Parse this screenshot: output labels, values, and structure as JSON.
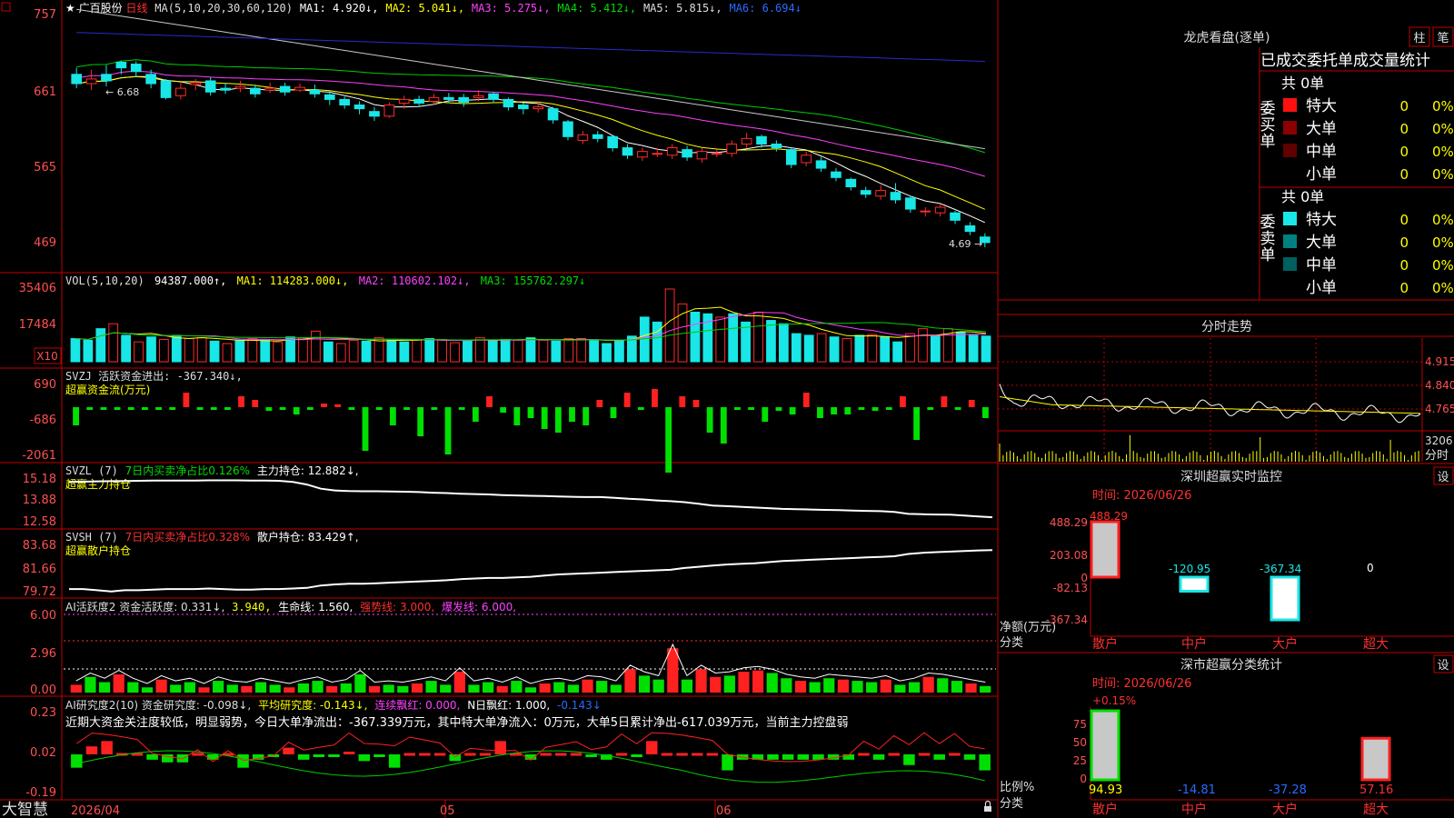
{
  "colors": {
    "bg": "#000000",
    "frame": "#c00000",
    "up": "#ff2a2a",
    "down": "#19e6e6",
    "ma1": "#ffffff",
    "ma2": "#ffff00",
    "ma3": "#ff40ff",
    "ma4": "#00cc00",
    "ma5": "#c8c8c8",
    "ma6": "#2a2ad0",
    "green": "#00e000",
    "red": "#ff2020",
    "text_white": "#ffffff",
    "text_yellow": "#ffff00",
    "text_green": "#00e000",
    "text_red": "#ff3030",
    "text_magenta": "#ff40ff",
    "text_blue": "#2a6aff",
    "label_red": "#ff5050"
  },
  "header": {
    "menu_icon": "square-menu-icon",
    "star": "★",
    "stock_name": "广百股份",
    "period": "日线",
    "ma_label": "MA(5,10,20,30,60,120)",
    "ma1": "MA1: 4.920↓,",
    "ma2": "MA2: 5.041↓,",
    "ma3": "MA3: 5.275↓,",
    "ma4": "MA4: 5.412↓,",
    "ma5": "MA5: 5.815↓,",
    "ma6": "MA6: 6.694↓"
  },
  "panels": {
    "price": {
      "ticks": [
        "757",
        "661",
        "565",
        "469"
      ],
      "high_label": "6.68",
      "low_label": "4.69"
    },
    "vol": {
      "ticks": [
        "35406",
        "17484"
      ],
      "unit_badge": "X10",
      "title": "VOL(5,10,20)",
      "value": "94387.000↑,",
      "ma1": "MA1: 114283.000↓,",
      "ma2": "MA2: 110602.102↓,",
      "ma3": "MA3: 155762.297↓"
    },
    "svzj": {
      "ticks": [
        "690",
        "-686",
        "-2061"
      ],
      "title": "SVZJ  活跃资金进出: -367.340↓,",
      "subtitle": "超赢资金流(万元)"
    },
    "svzl": {
      "ticks": [
        "15.18",
        "13.88",
        "12.58"
      ],
      "title": "SVZL (7)",
      "t2": "7日内买卖净占比0.126%",
      "t3": "主力持仓: 12.882↓,",
      "subtitle": "超赢主力持仓"
    },
    "svsh": {
      "ticks": [
        "83.68",
        "81.66",
        "79.72"
      ],
      "title": "SVSH (7)",
      "t2": "7日内买卖净占比0.328%",
      "t3": "散户持仓: 83.429↑,",
      "subtitle": "超赢散户持仓"
    },
    "aihyd": {
      "ticks": [
        "6.00",
        "2.96",
        "0.00"
      ],
      "t1": "AI活跃度2 资金活跃度: 0.331↓,",
      "t2": "3.940,",
      "t3": "生命线: 1.560,",
      "t4": "强势线: 3.000,",
      "t5": "爆发线: 6.000,"
    },
    "aiyj": {
      "ticks": [
        "0.23",
        "0.02",
        "-0.19"
      ],
      "t1": "AI研究度2(10) 资金研究度: -0.098↓,",
      "t2": "平均研究度: -0.143↓,",
      "t3": "连续飘红: 0.000,",
      "t4": "N日飘红: 1.000,",
      "t5": "-0.143↓",
      "comment": "近期大资金关注度较低，明显弱势，今日大单净流出：-367.339万元，其中特大单净流入：0万元，大单5日累计净出-617.039万元，当前主力控盘弱"
    }
  },
  "xaxis": {
    "labels": [
      "2026/04",
      "05",
      "06"
    ]
  },
  "footer": {
    "brand": "大智慧",
    "lock_icon": "lock-icon"
  },
  "right": {
    "lhb": {
      "title": "龙虎看盘(逐单)",
      "btn1": "柱",
      "btn2": "笔",
      "subtitle": "已成交委托单成交量统计",
      "buy_label": "委买单",
      "sell_label": "委卖单",
      "buy_total": "共 0单",
      "sell_total": "共 0单",
      "buy_rows": [
        {
          "name": "特大",
          "val": "0",
          "pct": "0%"
        },
        {
          "name": "大单",
          "val": "0",
          "pct": "0%"
        },
        {
          "name": "中单",
          "val": "0",
          "pct": "0%"
        },
        {
          "name": "小单",
          "val": "0",
          "pct": "0%"
        }
      ],
      "sell_rows": [
        {
          "name": "特大",
          "val": "0",
          "pct": "0%"
        },
        {
          "name": "大单",
          "val": "0",
          "pct": "0%"
        },
        {
          "name": "中单",
          "val": "0",
          "pct": "0%"
        },
        {
          "name": "小单",
          "val": "0",
          "pct": "0%"
        }
      ]
    },
    "intraday": {
      "title": "分时走势",
      "ticks": [
        "4.915",
        "4.840",
        "4.765"
      ],
      "vol_label": "3206",
      "unit": "分时"
    },
    "szrt": {
      "title": "深圳超赢实时监控",
      "btn": "设",
      "date": "时间: 2026/06/26",
      "ylabel": "净额(万元)",
      "xlabel": "分类",
      "ticks": [
        "488.29",
        "203.08",
        "0",
        "-82.13",
        "-367.34"
      ],
      "categories": [
        "散户",
        "中户",
        "大户",
        "超大"
      ],
      "values": [
        488.29,
        -120.95,
        -367.34,
        0
      ],
      "value_labels": [
        "488.29",
        "-120.95",
        "-367.34",
        "0"
      ]
    },
    "szcls": {
      "title": "深市超赢分类统计",
      "btn": "设",
      "date": "时间: 2026/06/26",
      "ylabel": "比例%",
      "xlabel": "分类",
      "top_label": "+0.15%",
      "ticks": [
        "75",
        "50",
        "25",
        "0"
      ],
      "categories": [
        "散户",
        "中户",
        "大户",
        "超大"
      ],
      "values": [
        94.93,
        -14.81,
        -37.28,
        57.16
      ],
      "value_labels": [
        "94.93",
        "-14.81",
        "-37.28",
        "57.16"
      ]
    }
  },
  "chart_data": [
    {
      "type": "candlestick",
      "title": "广百股份 日线",
      "ylim": [
        4.6,
        7.6
      ],
      "ohlc": [
        [
          6.55,
          6.45,
          6.62,
          6.4
        ],
        [
          6.45,
          6.5,
          6.6,
          6.38
        ],
        [
          6.55,
          6.48,
          6.65,
          6.42
        ],
        [
          6.68,
          6.62,
          6.7,
          6.55
        ],
        [
          6.66,
          6.58,
          6.69,
          6.52
        ],
        [
          6.55,
          6.45,
          6.6,
          6.4
        ],
        [
          6.48,
          6.3,
          6.5,
          6.28
        ],
        [
          6.32,
          6.4,
          6.46,
          6.28
        ],
        [
          6.44,
          6.46,
          6.5,
          6.38
        ],
        [
          6.48,
          6.36,
          6.52,
          6.32
        ],
        [
          6.4,
          6.38,
          6.46,
          6.34
        ],
        [
          6.4,
          6.42,
          6.48,
          6.36
        ],
        [
          6.4,
          6.34,
          6.44,
          6.3
        ],
        [
          6.38,
          6.4,
          6.46,
          6.35
        ],
        [
          6.42,
          6.36,
          6.46,
          6.32
        ],
        [
          6.38,
          6.41,
          6.45,
          6.36
        ],
        [
          6.38,
          6.34,
          6.44,
          6.3
        ],
        [
          6.33,
          6.28,
          6.37,
          6.22
        ],
        [
          6.28,
          6.22,
          6.31,
          6.18
        ],
        [
          6.22,
          6.18,
          6.26,
          6.12
        ],
        [
          6.15,
          6.1,
          6.2,
          6.05
        ],
        [
          6.1,
          6.22,
          6.25,
          6.08
        ],
        [
          6.24,
          6.28,
          6.32,
          6.18
        ],
        [
          6.28,
          6.24,
          6.32,
          6.2
        ],
        [
          6.26,
          6.3,
          6.34,
          6.22
        ],
        [
          6.3,
          6.28,
          6.35,
          6.24
        ],
        [
          6.3,
          6.25,
          6.34,
          6.2
        ],
        [
          6.3,
          6.32,
          6.38,
          6.26
        ],
        [
          6.34,
          6.28,
          6.36,
          6.24
        ],
        [
          6.28,
          6.2,
          6.3,
          6.16
        ],
        [
          6.22,
          6.18,
          6.24,
          6.12
        ],
        [
          6.18,
          6.2,
          6.26,
          6.14
        ],
        [
          6.18,
          6.06,
          6.2,
          6.02
        ],
        [
          6.04,
          5.88,
          6.06,
          5.84
        ],
        [
          5.84,
          5.9,
          5.94,
          5.8
        ],
        [
          5.9,
          5.86,
          5.94,
          5.82
        ],
        [
          5.88,
          5.76,
          5.9,
          5.72
        ],
        [
          5.76,
          5.68,
          5.8,
          5.64
        ],
        [
          5.66,
          5.72,
          5.76,
          5.62
        ],
        [
          5.7,
          5.7,
          5.76,
          5.66
        ],
        [
          5.68,
          5.76,
          5.8,
          5.64
        ],
        [
          5.74,
          5.66,
          5.78,
          5.62
        ],
        [
          5.64,
          5.72,
          5.76,
          5.6
        ],
        [
          5.7,
          5.7,
          5.74,
          5.66
        ],
        [
          5.7,
          5.8,
          5.84,
          5.66
        ],
        [
          5.8,
          5.86,
          5.92,
          5.76
        ],
        [
          5.88,
          5.8,
          5.9,
          5.76
        ],
        [
          5.8,
          5.76,
          5.84,
          5.72
        ],
        [
          5.74,
          5.58,
          5.76,
          5.54
        ],
        [
          5.6,
          5.68,
          5.72,
          5.56
        ],
        [
          5.62,
          5.54,
          5.66,
          5.5
        ],
        [
          5.5,
          5.44,
          5.54,
          5.4
        ],
        [
          5.42,
          5.34,
          5.44,
          5.3
        ],
        [
          5.3,
          5.26,
          5.34,
          5.22
        ],
        [
          5.24,
          5.3,
          5.36,
          5.2
        ],
        [
          5.28,
          5.2,
          5.38,
          5.16
        ],
        [
          5.22,
          5.1,
          5.24,
          5.06
        ],
        [
          5.08,
          5.08,
          5.12,
          5.02
        ],
        [
          5.06,
          5.12,
          5.16,
          5.02
        ],
        [
          5.06,
          4.98,
          5.08,
          4.94
        ],
        [
          4.92,
          4.86,
          4.96,
          4.82
        ],
        [
          4.8,
          4.74,
          4.84,
          4.69
        ]
      ]
    },
    {
      "type": "bar",
      "title": "VOL(5,10,20)",
      "ylim": [
        0,
        50000
      ],
      "values": [
        14000,
        13000,
        20000,
        23000,
        16000,
        12000,
        15000,
        13500,
        16000,
        14000,
        14500,
        12500,
        11000,
        13000,
        14000,
        13000,
        12000,
        15000,
        14500,
        18500,
        12000,
        11000,
        13000,
        12500,
        14500,
        13000,
        12000,
        13500,
        14000,
        13500,
        11500,
        12500,
        14500,
        13000,
        13500,
        13000,
        14500,
        13000,
        12500,
        14000,
        14000,
        13000,
        11000,
        13000,
        15500,
        27000,
        24000,
        44000,
        35000,
        30000,
        29000,
        27000,
        29000,
        24000,
        30000,
        25000,
        23000,
        17000,
        16000,
        17000,
        15000,
        14000,
        16000,
        16500,
        15000,
        12000,
        17000,
        20000,
        16000,
        20000,
        18000,
        16000,
        15500
      ],
      "up": [
        0,
        0,
        0,
        1,
        0,
        1,
        0,
        1,
        0,
        1,
        1,
        0,
        1,
        0,
        1,
        0,
        1,
        0,
        1,
        1,
        0,
        1,
        1,
        0,
        1,
        0,
        0,
        1,
        0,
        1,
        1,
        0,
        1,
        0,
        0,
        1,
        0,
        1,
        0,
        1,
        1,
        0,
        0,
        0,
        0,
        0,
        0,
        1,
        1,
        0,
        0,
        1,
        0,
        0,
        1,
        0,
        0,
        0,
        0,
        1,
        0,
        1,
        0,
        1,
        0,
        0,
        1,
        1,
        0,
        1,
        0,
        0,
        0
      ]
    },
    {
      "type": "bar",
      "title": "超赢资金流(万元)",
      "ylim": [
        -2061,
        690
      ],
      "values": [
        -500,
        0,
        0,
        0,
        0,
        0,
        0,
        0,
        400,
        0,
        0,
        0,
        300,
        200,
        -100,
        0,
        -200,
        0,
        100,
        80,
        0,
        -1200,
        0,
        -500,
        0,
        -800,
        0,
        -1300,
        0,
        -400,
        300,
        -150,
        -500,
        -300,
        -600,
        -700,
        -400,
        -500,
        200,
        -300,
        400,
        0,
        500,
        -1800,
        300,
        200,
        -700,
        -1000,
        0,
        0,
        -400,
        -100,
        -200,
        400,
        -300,
        -200,
        -200,
        0,
        -100,
        0,
        300,
        -900,
        0,
        300,
        0,
        200,
        -300
      ]
    },
    {
      "type": "line",
      "title": "超赢主力持仓",
      "ylim": [
        12.58,
        15.18
      ],
      "values": [
        15.0,
        15.02,
        15.04,
        15.05,
        15.06,
        15.07,
        15.08,
        15.08,
        15.09,
        15.09,
        15.1,
        15.1,
        15.1,
        15.09,
        15.08,
        15.07,
        15.0,
        14.85,
        14.6,
        14.5,
        14.46,
        14.45,
        14.45,
        14.44,
        14.42,
        14.4,
        14.36,
        14.34,
        14.3,
        14.28,
        14.26,
        14.22,
        14.2,
        14.18,
        14.16,
        14.14,
        14.12,
        14.1,
        14.1,
        14.06,
        14.0,
        13.96,
        13.9,
        13.86,
        13.8,
        13.7,
        13.6,
        13.56,
        13.52,
        13.48,
        13.44,
        13.4,
        13.38,
        13.36,
        13.34,
        13.32,
        13.3,
        13.28,
        13.26,
        13.22,
        13.1,
        13.08,
        13.06,
        13.05,
        13.0,
        12.95,
        12.9
      ]
    },
    {
      "type": "line",
      "title": "超赢散户持仓",
      "ylim": [
        79.72,
        83.68
      ],
      "values": [
        80.1,
        80.1,
        80.0,
        79.9,
        80.0,
        80.0,
        80.05,
        80.1,
        80.1,
        80.1,
        80.15,
        80.1,
        80.05,
        80.05,
        80.1,
        80.1,
        80.15,
        80.2,
        80.4,
        80.5,
        80.55,
        80.55,
        80.6,
        80.65,
        80.7,
        80.75,
        80.8,
        80.85,
        80.95,
        81.0,
        81.05,
        81.05,
        81.1,
        81.15,
        81.25,
        81.35,
        81.4,
        81.45,
        81.5,
        81.55,
        81.6,
        81.65,
        81.7,
        81.75,
        81.9,
        82.0,
        82.1,
        82.2,
        82.25,
        82.3,
        82.4,
        82.5,
        82.55,
        82.6,
        82.65,
        82.7,
        82.75,
        82.8,
        82.85,
        82.9,
        83.1,
        83.2,
        83.25,
        83.3,
        83.35,
        83.4,
        83.43
      ]
    },
    {
      "type": "bar",
      "title": "AI活跃度2",
      "ylim": [
        0,
        6
      ],
      "values": [
        0.6,
        1.2,
        0.8,
        1.4,
        0.8,
        0.4,
        1.0,
        0.6,
        0.8,
        0.4,
        0.9,
        0.6,
        0.5,
        0.8,
        0.6,
        0.4,
        0.7,
        0.9,
        0.5,
        0.7,
        1.4,
        0.5,
        0.6,
        0.5,
        0.7,
        0.9,
        0.6,
        1.6,
        0.6,
        0.8,
        0.5,
        0.9,
        0.4,
        0.7,
        0.8,
        0.6,
        1.0,
        0.9,
        0.6,
        1.8,
        1.3,
        1.0,
        3.4,
        1.0,
        1.8,
        1.2,
        1.3,
        1.6,
        1.7,
        1.5,
        1.1,
        0.9,
        0.8,
        1.1,
        1.0,
        0.9,
        0.8,
        1.0,
        0.6,
        0.8,
        1.2,
        1.1,
        0.9,
        0.7,
        0.5
      ]
    },
    {
      "type": "bar",
      "title": "AI研究度2(10)",
      "ylim": [
        -0.19,
        0.23
      ],
      "values": [
        -0.1,
        0.06,
        0.1,
        0.0,
        0.0,
        -0.04,
        -0.06,
        -0.06,
        0.0,
        -0.04,
        0.0,
        -0.1,
        -0.04,
        -0.02,
        0.05,
        -0.04,
        -0.02,
        -0.02,
        0.02,
        -0.05,
        -0.02,
        -0.1,
        0.0,
        0.0,
        0.0,
        -0.05,
        0.0,
        0.0,
        0.1,
        0.0,
        -0.04,
        0.0,
        0.0,
        0.0,
        -0.02,
        -0.04,
        0.0,
        -0.02,
        0.1,
        0.0,
        0.0,
        0.0,
        0.0,
        -0.12,
        -0.04,
        -0.04,
        -0.04,
        -0.04,
        -0.04,
        -0.04,
        -0.04,
        -0.04,
        0.0,
        -0.04,
        0.0,
        -0.08,
        0.0,
        -0.04,
        0.0,
        -0.04,
        -0.12
      ]
    },
    {
      "type": "bar",
      "title": "深圳超赢实时监控",
      "categories": [
        "散户",
        "中户",
        "大户",
        "超大"
      ],
      "values": [
        488.29,
        -120.95,
        -367.34,
        0
      ],
      "ylabel": "净额(万元)",
      "ylim": [
        -367.34,
        488.29
      ]
    },
    {
      "type": "bar",
      "title": "深市超赢分类统计",
      "categories": [
        "散户",
        "中户",
        "大户",
        "超大"
      ],
      "values": [
        94.93,
        -14.81,
        -37.28,
        57.16
      ],
      "ylabel": "比例%",
      "ylim": [
        0,
        100
      ]
    }
  ]
}
